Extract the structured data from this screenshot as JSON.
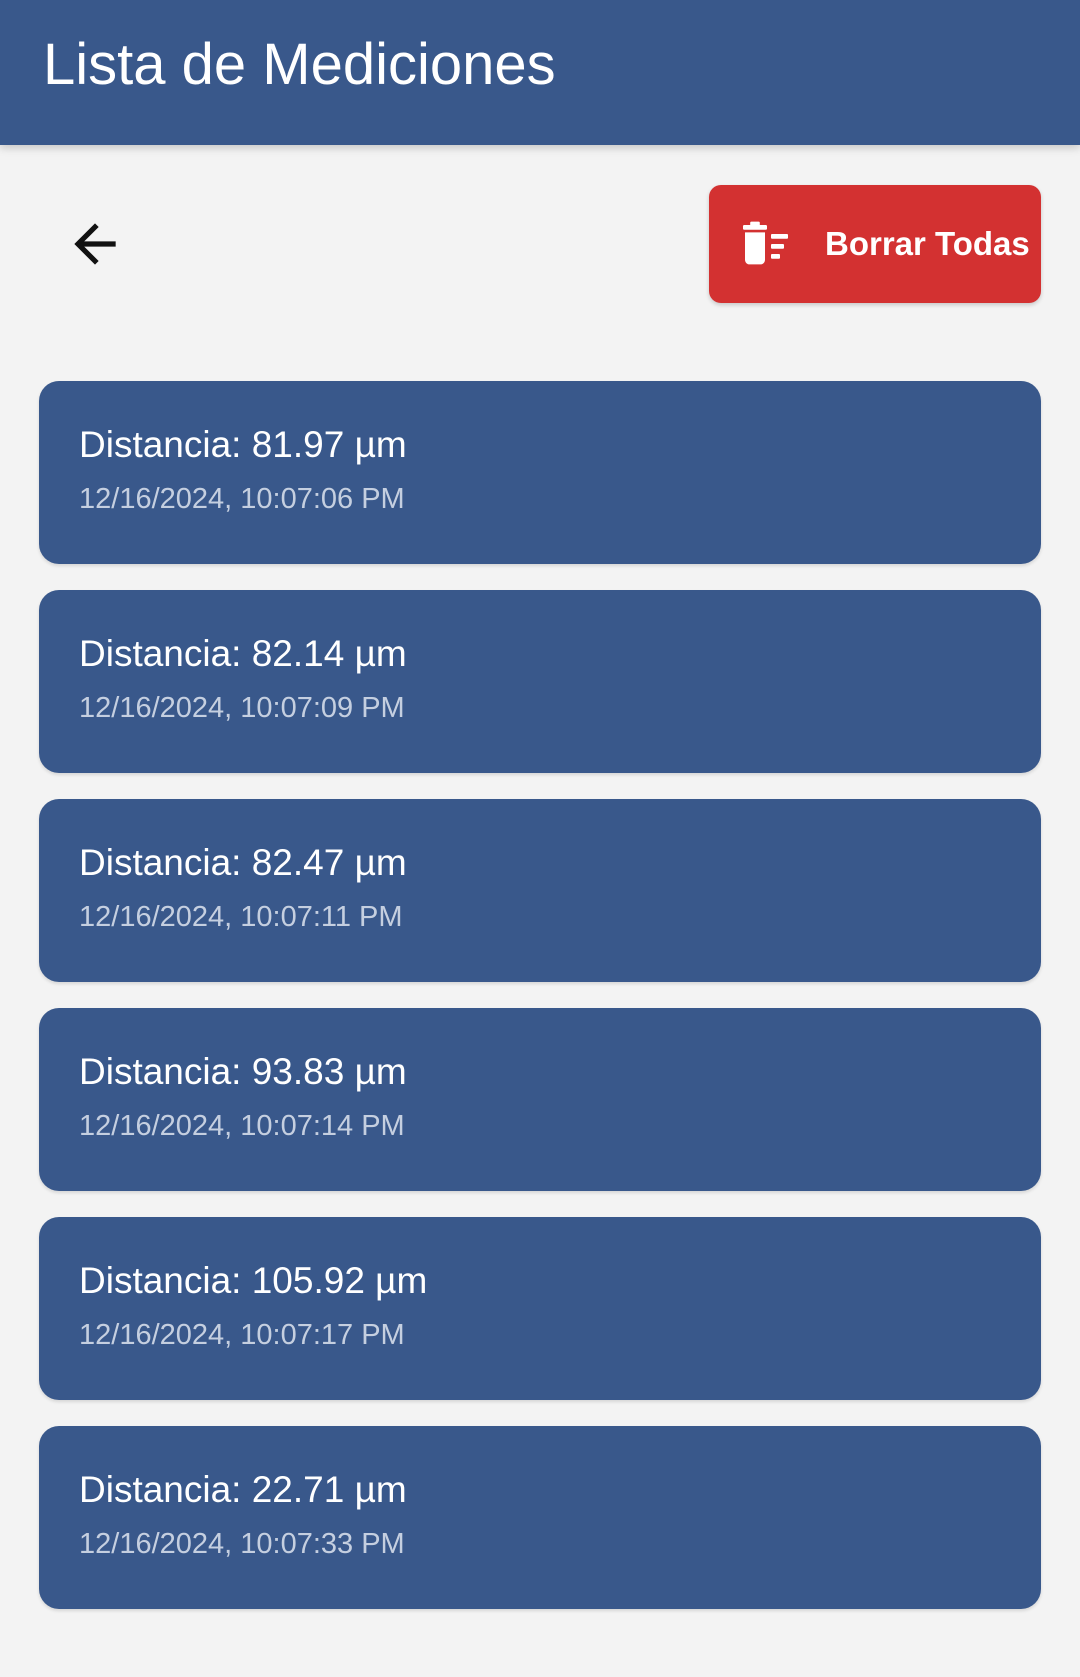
{
  "app_bar": {
    "title": "Lista de Mediciones"
  },
  "toolbar": {
    "back_icon": "arrow-left-icon",
    "delete_all_icon": "delete-sweep-icon",
    "delete_all_label": "Borrar Todas"
  },
  "colors": {
    "primary": "#39588b",
    "danger": "#d33131",
    "background": "#f3f3f3"
  },
  "measurements": [
    {
      "distance": "Distancia: 81.97 µm",
      "timestamp": "12/16/2024, 10:07:06 PM"
    },
    {
      "distance": "Distancia: 82.14 µm",
      "timestamp": "12/16/2024, 10:07:09 PM"
    },
    {
      "distance": "Distancia: 82.47 µm",
      "timestamp": "12/16/2024, 10:07:11 PM"
    },
    {
      "distance": "Distancia: 93.83 µm",
      "timestamp": "12/16/2024, 10:07:14 PM"
    },
    {
      "distance": "Distancia: 105.92 µm",
      "timestamp": "12/16/2024, 10:07:17 PM"
    },
    {
      "distance": "Distancia: 22.71 µm",
      "timestamp": "12/16/2024, 10:07:33 PM"
    }
  ]
}
